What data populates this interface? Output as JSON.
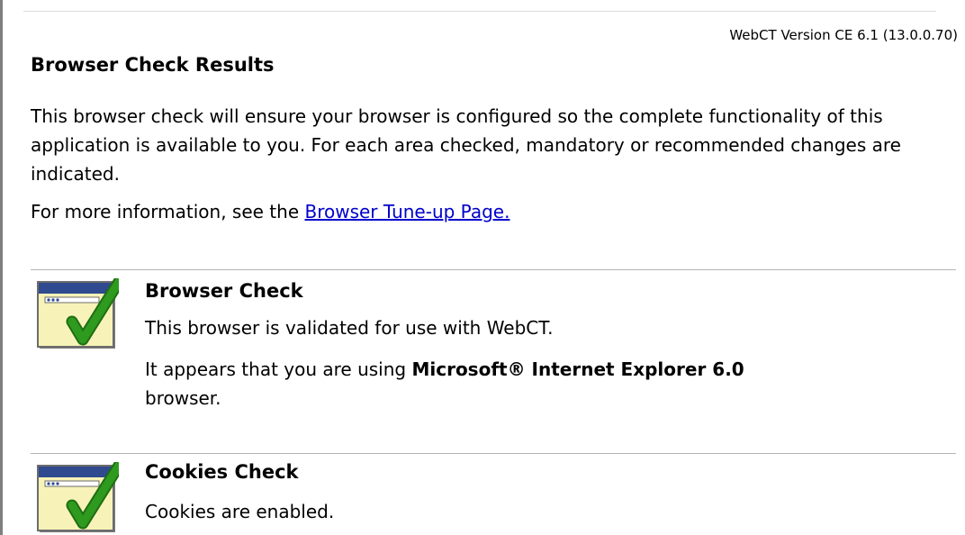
{
  "version_text": "WebCT Version CE 6.1 (13.0.0.70)",
  "page_title": "Browser Check Results",
  "intro": "This browser check will ensure your browser is configured so the complete functionality of this application is available to you. For each area checked, mandatory or recommended changes are indicated.",
  "more_info": {
    "prefix": "For more information, see the ",
    "link_label": "Browser Tune-up Page."
  },
  "sections": [
    {
      "icon": "window-checkmark-icon",
      "title": "Browser Check",
      "line1": "This browser is validated for use with WebCT.",
      "line2_prefix": "It appears that you are using ",
      "line2_bold": "Microsoft® Internet Explorer 6.0",
      "line3": "browser."
    },
    {
      "icon": "window-checkmark-icon",
      "title": "Cookies Check",
      "line1": "Cookies are enabled."
    }
  ],
  "colors": {
    "link": "#0000cc",
    "check": "#2e9a1e",
    "window_fill": "#f7f3b8",
    "window_title": "#2f4a8f"
  }
}
